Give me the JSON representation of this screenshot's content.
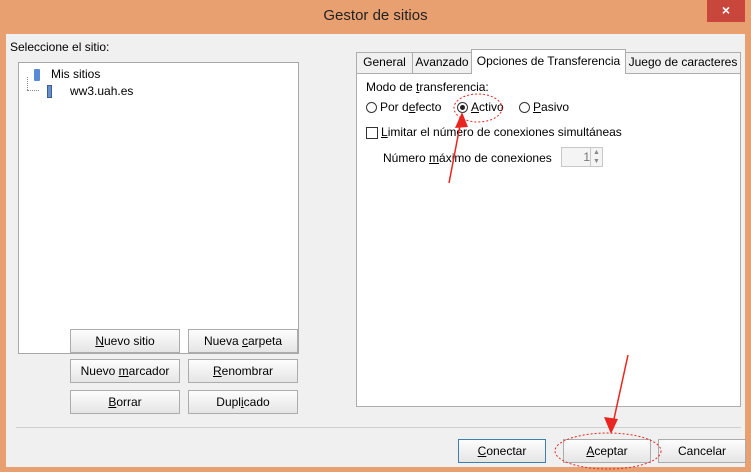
{
  "window": {
    "title": "Gestor de sitios",
    "close_glyph": "×"
  },
  "left": {
    "select_label": "Seleccione el sitio:",
    "tree": {
      "root_label": "Mis sitios",
      "site_label": "ww3.uah.es",
      "root_icon": "folder-icon",
      "site_icon": "server-icon"
    },
    "buttons": {
      "new_site_u": "N",
      "new_site_rest": "uevo sitio",
      "new_folder_a": "Nueva ",
      "new_folder_u": "c",
      "new_folder_b": "arpeta",
      "new_bookmark_a": "Nuevo ",
      "new_bookmark_u": "m",
      "new_bookmark_b": "arcador",
      "rename_u": "R",
      "rename_rest": "enombrar",
      "delete_u": "B",
      "delete_rest": "orrar",
      "duplicate_a": "Dupl",
      "duplicate_u": "i",
      "duplicate_b": "cado"
    }
  },
  "tabs": {
    "general": "General",
    "advanced": "Avanzado",
    "transfer": "Opciones de Transferencia",
    "charset": "Juego de caracteres",
    "active_tab": "transfer"
  },
  "transfer": {
    "mode_label_a": "Modo de ",
    "mode_label_u": "t",
    "mode_label_b": "ransferencia:",
    "options": {
      "default_a": "Por d",
      "default_u": "e",
      "default_b": "fecto",
      "active_u": "A",
      "active_b": "ctivo",
      "passive_u": "P",
      "passive_b": "asivo"
    },
    "selected_mode": "Activo",
    "limit_a": "",
    "limit_u": "L",
    "limit_b": "imitar el número de conexiones simultáneas",
    "limit_checked": false,
    "max_label_a": "Número ",
    "max_label_u": "m",
    "max_label_b": "áximo de conexiones",
    "max_value": "1"
  },
  "footer": {
    "connect_u": "C",
    "connect_rest": "onectar",
    "accept_u": "A",
    "accept_rest": "ceptar",
    "cancel": "Cancelar"
  },
  "annotations": {
    "color": "#e8261f"
  }
}
